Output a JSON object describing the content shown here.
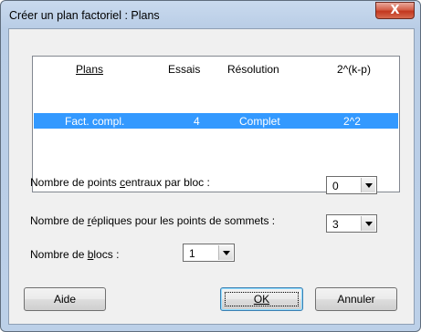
{
  "window": {
    "title": "Créer un plan factoriel : Plans",
    "close_glyph": "X"
  },
  "list": {
    "columns": [
      "Plans",
      "Essais",
      "Résolution",
      "2^(k-p)"
    ],
    "rows": [
      [
        "Fact. compl.",
        "4",
        "Complet",
        "2^2"
      ]
    ]
  },
  "center_points": {
    "label_before": "Nombre de points ",
    "label_ul": "c",
    "label_after": "entraux par bloc :",
    "value": "0"
  },
  "replicates": {
    "label_before": "Nombre de ",
    "label_ul": "r",
    "label_after": "éplique",
    "label_rest": "s pour les points de sommets :",
    "value": "3"
  },
  "blocks": {
    "label_before": "Nombre de ",
    "label_ul": "b",
    "label_after": "locs :",
    "value": "1"
  },
  "buttons": {
    "help": "Aide",
    "ok": "OK",
    "cancel": "Annuler"
  },
  "colors": {
    "selection": "#3399ff",
    "close_button": "#c2371f",
    "frame": "#bcd0e8"
  }
}
